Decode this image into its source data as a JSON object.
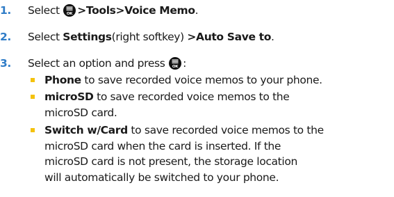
{
  "steps": [
    {
      "number": "1.",
      "prefix": "Select",
      "icon": "menu-ok-icon",
      "path": ">Tools>Voice Memo",
      "suffix": "."
    },
    {
      "number": "2.",
      "prefix": "Select",
      "bold1": "Settings",
      "mid": "(right softkey)",
      "bold2": ">Auto Save to",
      "suffix": "."
    },
    {
      "number": "3.",
      "text": "Select an option and press",
      "icon": "menu-ok-icon",
      "suffix": ":"
    }
  ],
  "options": [
    {
      "label": "Phone",
      "lines": [
        "to save recorded voice memos to your phone."
      ]
    },
    {
      "label": "microSD",
      "lines": [
        "to save recorded voice memos to the",
        "microSD card."
      ]
    },
    {
      "label": "Switch w/Card",
      "lines": [
        "to save recorded voice memos to the",
        "microSD card when the card is inserted. If the",
        "microSD card is not present, the storage location",
        "will automatically be switched to your phone."
      ]
    }
  ],
  "colors": {
    "step_number": "#2f7cc7",
    "bullet": "#f4c20d",
    "text": "#1a1a1a"
  }
}
